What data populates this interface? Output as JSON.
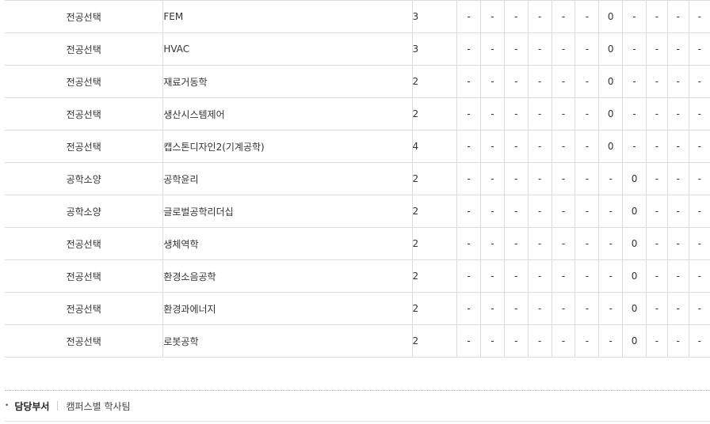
{
  "rows": [
    {
      "type": "전공선택",
      "name": "FEM",
      "credit": "3",
      "cells": [
        "-",
        "-",
        "-",
        "-",
        "-",
        "-",
        "0",
        "-",
        "-",
        "-",
        "-"
      ]
    },
    {
      "type": "전공선택",
      "name": "HVAC",
      "credit": "3",
      "cells": [
        "-",
        "-",
        "-",
        "-",
        "-",
        "-",
        "0",
        "-",
        "-",
        "-",
        "-"
      ]
    },
    {
      "type": "전공선택",
      "name": "재료거동학",
      "credit": "2",
      "cells": [
        "-",
        "-",
        "-",
        "-",
        "-",
        "-",
        "0",
        "-",
        "-",
        "-",
        "-"
      ]
    },
    {
      "type": "전공선택",
      "name": "생산시스템제어",
      "credit": "2",
      "cells": [
        "-",
        "-",
        "-",
        "-",
        "-",
        "-",
        "0",
        "-",
        "-",
        "-",
        "-"
      ]
    },
    {
      "type": "전공선택",
      "name": "캡스톤디자인2(기계공학)",
      "credit": "4",
      "cells": [
        "-",
        "-",
        "-",
        "-",
        "-",
        "-",
        "0",
        "-",
        "-",
        "-",
        "-"
      ]
    },
    {
      "type": "공학소양",
      "name": "공학윤리",
      "credit": "2",
      "cells": [
        "-",
        "-",
        "-",
        "-",
        "-",
        "-",
        "-",
        "0",
        "-",
        "-",
        "-"
      ]
    },
    {
      "type": "공학소양",
      "name": "글로벌공학리더십",
      "credit": "2",
      "cells": [
        "-",
        "-",
        "-",
        "-",
        "-",
        "-",
        "-",
        "0",
        "-",
        "-",
        "-"
      ]
    },
    {
      "type": "전공선택",
      "name": "생체역학",
      "credit": "2",
      "cells": [
        "-",
        "-",
        "-",
        "-",
        "-",
        "-",
        "-",
        "0",
        "-",
        "-",
        "-"
      ]
    },
    {
      "type": "전공선택",
      "name": "환경소음공학",
      "credit": "2",
      "cells": [
        "-",
        "-",
        "-",
        "-",
        "-",
        "-",
        "-",
        "0",
        "-",
        "-",
        "-"
      ]
    },
    {
      "type": "전공선택",
      "name": "환경과에너지",
      "credit": "2",
      "cells": [
        "-",
        "-",
        "-",
        "-",
        "-",
        "-",
        "-",
        "0",
        "-",
        "-",
        "-"
      ]
    },
    {
      "type": "전공선택",
      "name": "로봇공학",
      "credit": "2",
      "cells": [
        "-",
        "-",
        "-",
        "-",
        "-",
        "-",
        "-",
        "0",
        "-",
        "-",
        "-"
      ]
    }
  ],
  "department": {
    "label": "담당부서",
    "value": "캠퍼스별 학사팀"
  }
}
